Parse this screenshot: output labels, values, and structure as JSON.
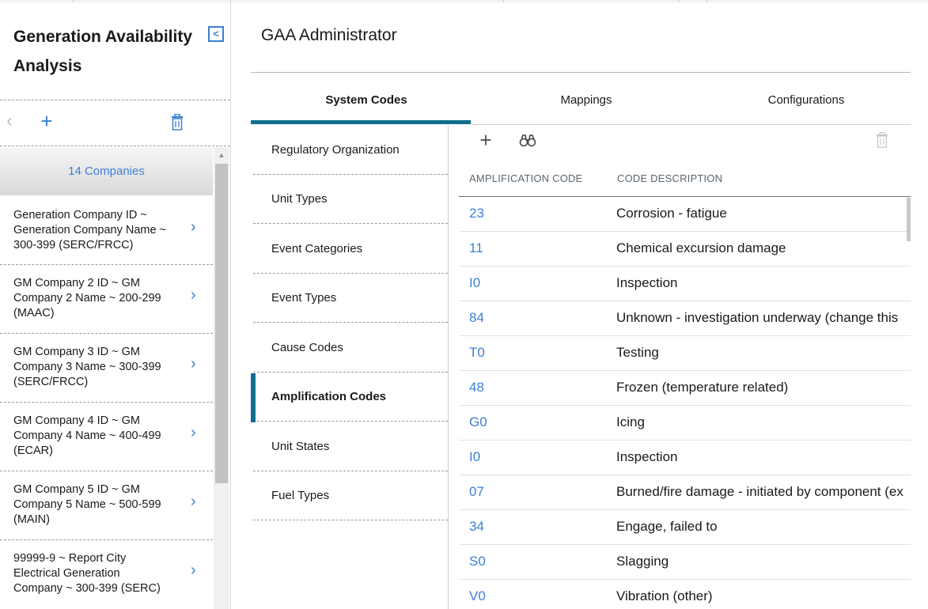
{
  "app": {
    "title": "Generation Availability Analysis",
    "collapse_icon": "collapse-left-icon",
    "accent_color": "#3d7fd6",
    "teal_color": "#0f6e8c"
  },
  "sidebar": {
    "list_header": "14 Companies",
    "companies": [
      {
        "lines": [
          "Generation Company ID ~",
          "Generation Company Name ~",
          "300-399 (SERC/FRCC)"
        ]
      },
      {
        "lines": [
          "GM Company 2 ID ~ GM",
          "Company 2 Name ~ 200-299",
          "(MAAC)"
        ]
      },
      {
        "lines": [
          "GM Company 3 ID ~ GM",
          "Company 3 Name ~ 300-399",
          "(SERC/FRCC)"
        ]
      },
      {
        "lines": [
          "GM Company 4 ID ~ GM",
          "Company 4 Name ~ 400-499",
          "(ECAR)"
        ]
      },
      {
        "lines": [
          "GM Company 5 ID ~ GM",
          "Company 5 Name ~ 500-599",
          "(MAIN)"
        ]
      },
      {
        "lines": [
          "99999-9 ~ Report City",
          "Electrical Generation",
          "Company ~ 300-399 (SERC)"
        ]
      }
    ]
  },
  "main": {
    "title": "GAA Administrator",
    "tabs": [
      {
        "label": "System Codes"
      },
      {
        "label": "Mappings"
      },
      {
        "label": "Configurations"
      }
    ],
    "subnav": [
      {
        "label": "Regulatory Organization"
      },
      {
        "label": "Unit Types"
      },
      {
        "label": "Event Categories"
      },
      {
        "label": "Event Types"
      },
      {
        "label": "Cause Codes"
      },
      {
        "label": "Amplification Codes"
      },
      {
        "label": "Unit States"
      },
      {
        "label": "Fuel Types"
      }
    ],
    "grid": {
      "headers": {
        "code": "AMPLIFICATION CODE",
        "description": "CODE DESCRIPTION"
      },
      "rows": [
        {
          "code": "23",
          "desc": "Corrosion - fatigue"
        },
        {
          "code": "11",
          "desc": "Chemical excursion damage"
        },
        {
          "code": "I0",
          "desc": "Inspection"
        },
        {
          "code": "84",
          "desc": "Unknown - investigation underway (change this"
        },
        {
          "code": "T0",
          "desc": "Testing"
        },
        {
          "code": "48",
          "desc": "Frozen (temperature related)"
        },
        {
          "code": "G0",
          "desc": "Icing"
        },
        {
          "code": "I0",
          "desc": "Inspection"
        },
        {
          "code": "07",
          "desc": "Burned/fire damage - initiated by component (ex"
        },
        {
          "code": "34",
          "desc": "Engage, failed to"
        },
        {
          "code": "S0",
          "desc": "Slagging"
        },
        {
          "code": "V0",
          "desc": "Vibration (other)"
        }
      ]
    }
  }
}
